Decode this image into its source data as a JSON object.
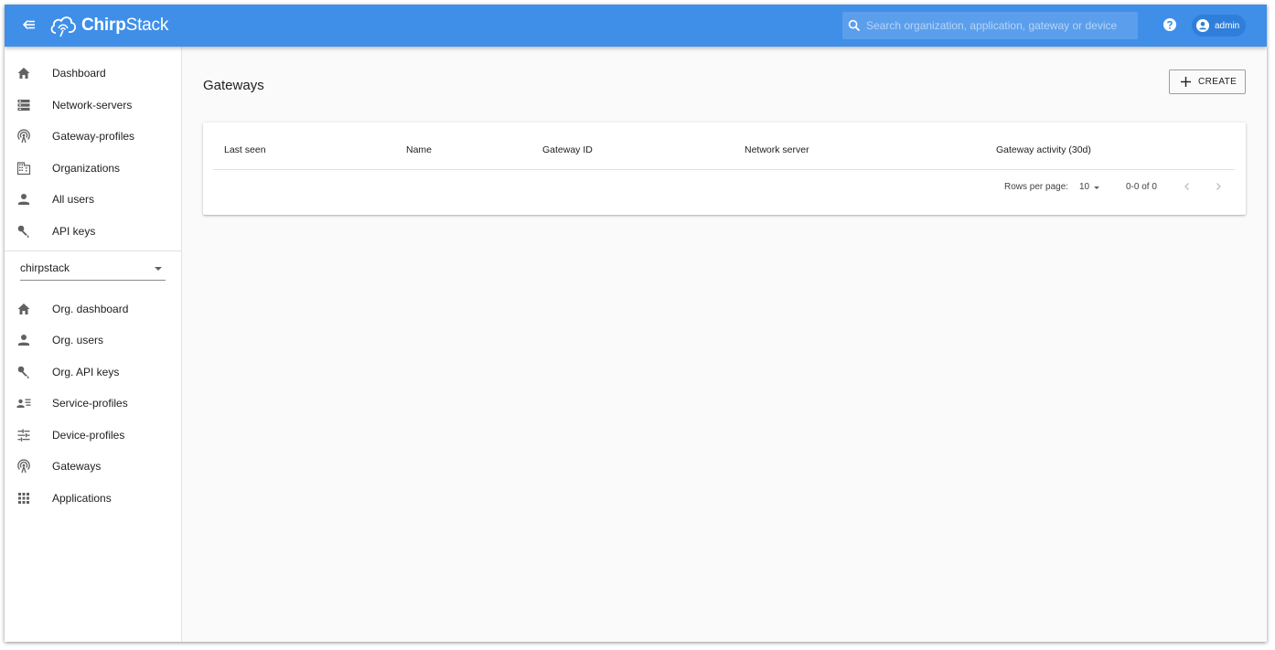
{
  "app": {
    "logo_text_bold": "Chirp",
    "logo_text_light": "Stack"
  },
  "header": {
    "search_placeholder": "Search organization, application, gateway or device",
    "user_name": "admin"
  },
  "sidebar": {
    "global_items": [
      {
        "label": "Dashboard",
        "icon": "home-icon"
      },
      {
        "label": "Network-servers",
        "icon": "server-icon"
      },
      {
        "label": "Gateway-profiles",
        "icon": "gateway-antenna-icon"
      },
      {
        "label": "Organizations",
        "icon": "building-icon"
      },
      {
        "label": "All users",
        "icon": "person-icon"
      },
      {
        "label": "API keys",
        "icon": "key-icon"
      }
    ],
    "org_selected": "chirpstack",
    "org_items": [
      {
        "label": "Org. dashboard",
        "icon": "home-icon"
      },
      {
        "label": "Org. users",
        "icon": "person-icon"
      },
      {
        "label": "Org. API keys",
        "icon": "key-icon"
      },
      {
        "label": "Service-profiles",
        "icon": "account-details-icon"
      },
      {
        "label": "Device-profiles",
        "icon": "tune-icon"
      },
      {
        "label": "Gateways",
        "icon": "gateway-antenna-icon"
      },
      {
        "label": "Applications",
        "icon": "apps-grid-icon"
      }
    ]
  },
  "main": {
    "title": "Gateways",
    "create_label": "CREATE",
    "table": {
      "columns": [
        "Last seen",
        "Name",
        "Gateway ID",
        "Network server",
        "Gateway activity (30d)"
      ],
      "rows": []
    },
    "pagination": {
      "rows_per_page_label": "Rows per page:",
      "rows_per_page_value": "10",
      "range_text": "0-0 of 0"
    }
  },
  "colors": {
    "appbar": "#3f8fe9",
    "background": "#fafafa"
  }
}
